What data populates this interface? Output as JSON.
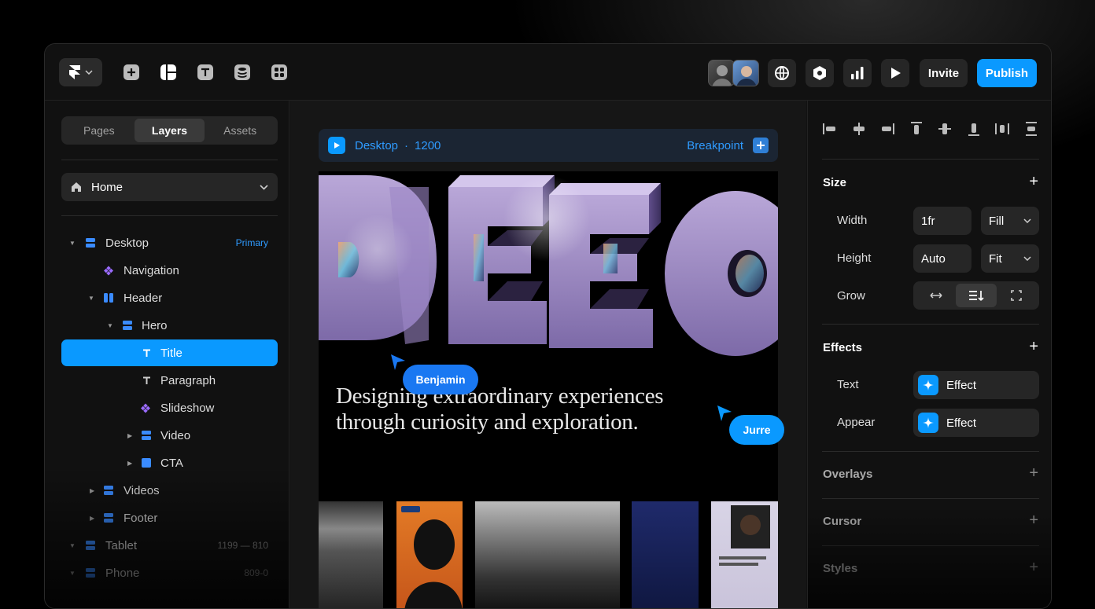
{
  "toolbar": {
    "invite_label": "Invite",
    "publish_label": "Publish",
    "colors": {
      "accent": "#0a99ff"
    }
  },
  "left_panel": {
    "tabs": [
      {
        "label": "Pages"
      },
      {
        "label": "Layers",
        "active": true
      },
      {
        "label": "Assets"
      }
    ],
    "page_select": "Home",
    "layers": [
      {
        "label": "Desktop",
        "badge": "Primary"
      },
      {
        "label": "Navigation"
      },
      {
        "label": "Header"
      },
      {
        "label": "Hero"
      },
      {
        "label": "Title",
        "selected": true
      },
      {
        "label": "Paragraph"
      },
      {
        "label": "Slideshow"
      },
      {
        "label": "Video"
      },
      {
        "label": "CTA"
      },
      {
        "label": "Videos"
      },
      {
        "label": "Footer"
      },
      {
        "label": "Tablet",
        "range": "1199 — 810"
      },
      {
        "label": "Phone",
        "range": "809-0"
      }
    ]
  },
  "canvas": {
    "breakpoint_name": "Desktop",
    "breakpoint_separator": "·",
    "breakpoint_width": "1200",
    "breakpoint_button": "Breakpoint",
    "hero_line1": "Designing extraordinary experiences",
    "hero_line2": "through curiosity and exploration.",
    "cursor_benjamin": "Benjamin",
    "cursor_jurre": "Jurre"
  },
  "right_panel": {
    "size_title": "Size",
    "width_label": "Width",
    "width_value": "1fr",
    "width_mode": "Fill",
    "height_label": "Height",
    "height_value": "Auto",
    "height_mode": "Fit",
    "grow_label": "Grow",
    "effects_title": "Effects",
    "text_label": "Text",
    "text_effect": "Effect",
    "appear_label": "Appear",
    "appear_effect": "Effect",
    "overlays_title": "Overlays",
    "cursor_title": "Cursor",
    "styles_title": "Styles"
  }
}
